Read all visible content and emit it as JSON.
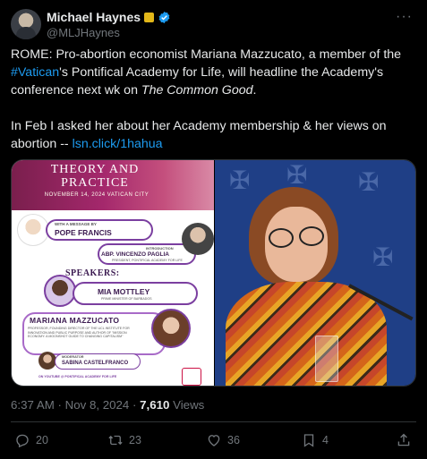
{
  "author": {
    "name": "Michael Haynes",
    "handle": "@MLJHaynes"
  },
  "tweet": {
    "para1_a": "ROME: Pro-abortion economist Mariana Mazzucato, a member of the ",
    "hashtag": "#Vatican",
    "para1_b": "'s Pontifical Academy for Life, will headline the Academy's conference next wk on ",
    "para1_italic": "The Common Good",
    "para1_c": ".",
    "para2_a": "In Feb I asked her about her Academy membership & her views on abortion -- ",
    "link": "lsn.click/1hahua"
  },
  "poster": {
    "title_line1": "THEORY AND",
    "title_line2": "PRACTICE",
    "date": "NOVEMBER 14, 2024 VATICAN CITY",
    "message_label": "WITH A MESSAGE BY",
    "pope": "POPE FRANCIS",
    "intro_label": "INTRODUCTION",
    "paglia": "ABP. VINCENZO PAGLIA",
    "paglia_role": "PRESIDENT, PONTIFICAL ACADEMY FOR LIFE",
    "speakers": "SPEAKERS:",
    "mottley": "MIA MOTTLEY",
    "mottley_role": "PRIME MINISTER OF BARBADOS",
    "mazzucato": "MARIANA MAZZUCATO",
    "mazzucato_role": "PROFESSOR, FOUNDING DIRECTOR OF THE UCL INSTITUTE FOR INNOVATION AND PUBLIC PURPOSE AND AUTHOR OF \"MISSION ECONOMY: A MOONSHOT GUIDE TO CHANGING CAPITALISM\"",
    "moderator_label": "MODERATOR",
    "moderator": "SABINA CASTELFRANCO",
    "footer": "ON YOUTUBE @ PONTIFICAL ACADEMY FOR LIFE"
  },
  "meta": {
    "time": "6:37 AM · Nov 8, 2024 · ",
    "views_count": "7,610",
    "views_label": " Views"
  },
  "actions": {
    "replies": "20",
    "reposts": "23",
    "likes": "36",
    "bookmarks": "4"
  },
  "colors": {
    "link": "#1d9bf0",
    "verified": "#1d9bf0",
    "gold_badge": "#e2b719",
    "poster_accent": "#7b3fa0"
  }
}
